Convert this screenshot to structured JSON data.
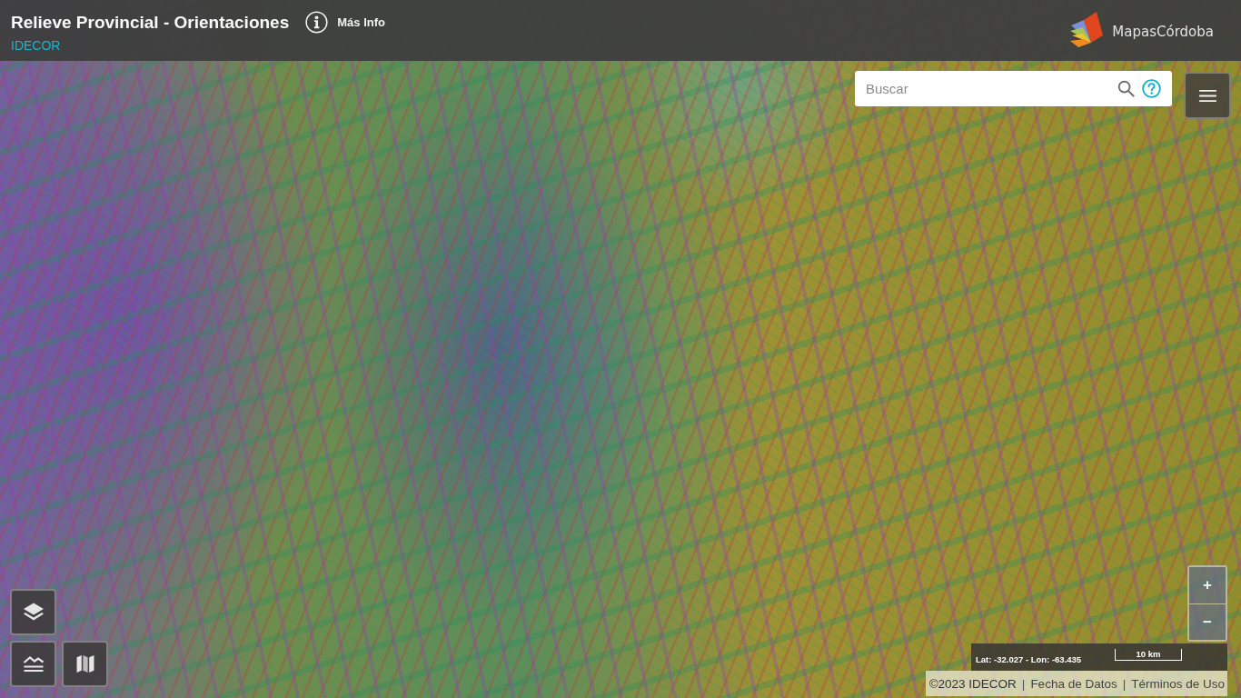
{
  "header": {
    "title": "Relieve Provincial - Orientaciones",
    "subtitle": "IDECOR",
    "info_link": "Más Info",
    "logo_text": "MapasCórdoba"
  },
  "search": {
    "placeholder": "Buscar"
  },
  "map_tools": [
    {
      "kind": "layers"
    },
    {
      "kind": "relief"
    },
    {
      "kind": "basemap"
    }
  ],
  "zoom": {
    "in_label": "+",
    "out_label": "−"
  },
  "status": {
    "coordinates": "Lat: -32.027 - Lon: -63.435",
    "scale": "10 km"
  },
  "attribution": [
    {
      "kind": "text",
      "text": "©2023 IDECOR"
    },
    {
      "kind": "separator",
      "text": "|"
    },
    {
      "kind": "link",
      "text": "Fecha de Datos"
    },
    {
      "kind": "separator",
      "text": "|"
    },
    {
      "kind": "link",
      "text": "Términos de Uso"
    }
  ]
}
